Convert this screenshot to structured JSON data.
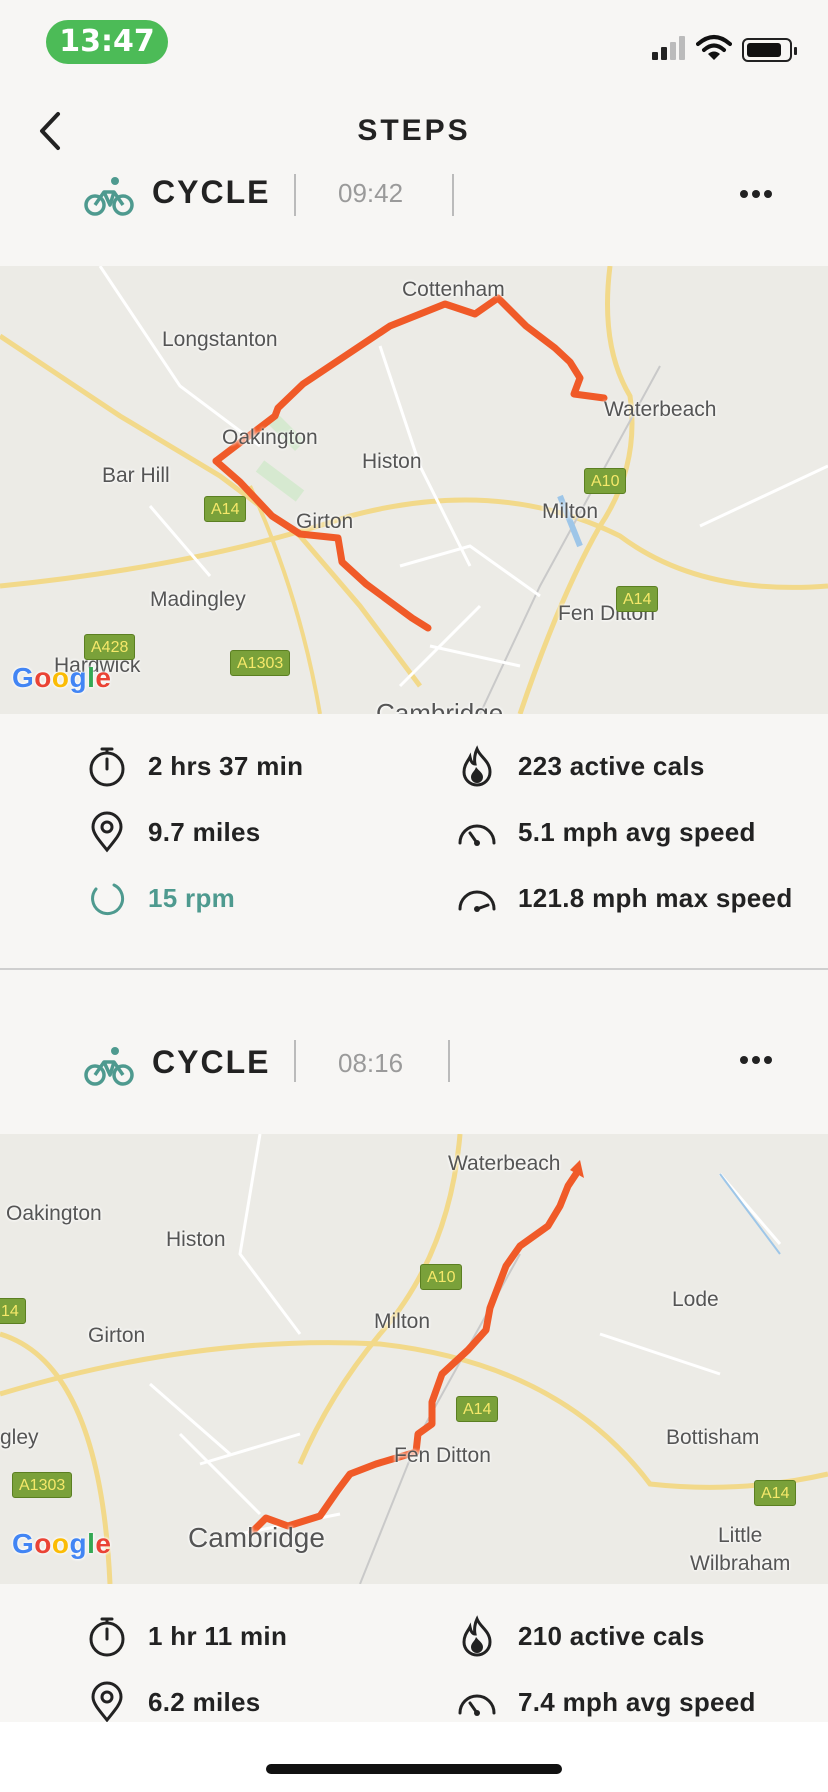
{
  "status_bar": {
    "time": "13:47"
  },
  "header": {
    "title": "STEPS"
  },
  "activities": [
    {
      "name": "CYCLE",
      "time": "09:42",
      "map_labels": [
        "Cottenham",
        "Longstanton",
        "Waterbeach",
        "Oakington",
        "Histon",
        "Bar Hill",
        "Milton",
        "Girton",
        "Madingley",
        "Fen Ditton",
        "Hardwick",
        "Cambridge"
      ],
      "road_shields": [
        "A10",
        "A14",
        "A14",
        "A428",
        "A1303"
      ],
      "map_attribution": "Google",
      "stats": {
        "duration": "2 hrs 37 min",
        "active_cals": "223 active cals",
        "distance": "9.7 miles",
        "avg_speed": "5.1 mph avg speed",
        "cadence": "15 rpm",
        "max_speed": "121.8 mph max speed"
      }
    },
    {
      "name": "CYCLE",
      "time": "08:16",
      "map_labels": [
        "Waterbeach",
        "Oakington",
        "Histon",
        "Lode",
        "Girton",
        "Milton",
        "gley",
        "Bottisham",
        "Fen Ditton",
        "Cambridge",
        "Little",
        "Wilbraham"
      ],
      "road_shields": [
        "A10",
        "14",
        "A14",
        "A1303",
        "A14"
      ],
      "map_attribution": "Google",
      "stats": {
        "duration": "1 hr 11 min",
        "active_cals": "210 active cals",
        "distance": "6.2 miles",
        "avg_speed": "7.4 mph avg speed"
      }
    }
  ],
  "colors": {
    "accent_green": "#4cbb57",
    "route": "#f05a28",
    "teal_icon": "#4e9a8f",
    "cadence_text": "#4e9a8f"
  }
}
